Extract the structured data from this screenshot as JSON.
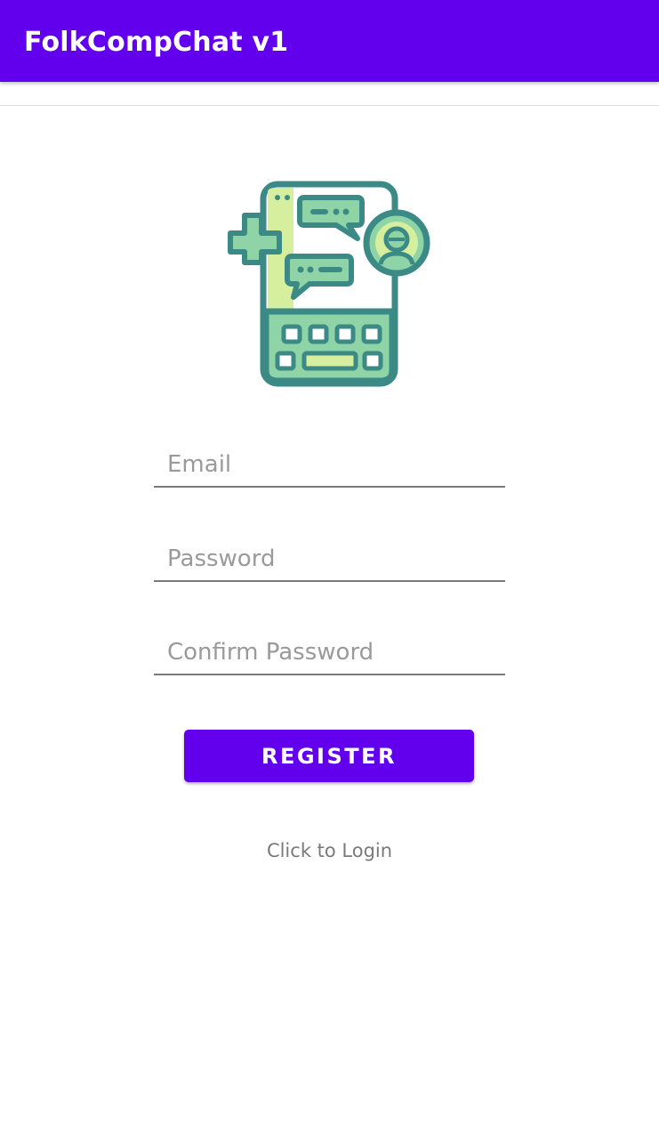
{
  "app_bar": {
    "title": "FolkCompChat v1",
    "color": "#6200EE"
  },
  "logo": {
    "icon": "chat-phone-app-logo-icon",
    "colors": {
      "outline": "#3B8A86",
      "fill_green": "#8FD4A6",
      "fill_lime": "#D6EF9E",
      "fill_white": "#FFFFFF"
    }
  },
  "form": {
    "email": {
      "value": "",
      "placeholder": "Email"
    },
    "password": {
      "value": "",
      "placeholder": "Password"
    },
    "confirm_password": {
      "value": "",
      "placeholder": "Confirm Password"
    }
  },
  "register_button": {
    "label": "REGISTER",
    "color": "#6200EE"
  },
  "login_link": {
    "label": "Click to Login"
  }
}
